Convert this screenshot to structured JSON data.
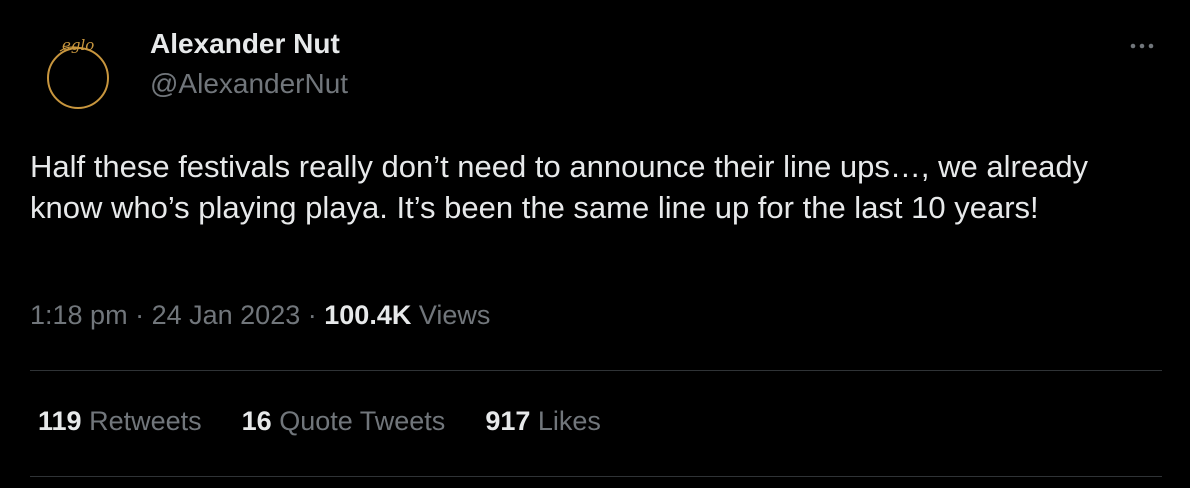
{
  "author": {
    "name": "Alexander Nut",
    "handle": "@AlexanderNut",
    "avatar_text": "eglo",
    "avatar_color": "#c8963e"
  },
  "tweet": {
    "text": "Half these festivals really don’t need to announce their line ups…, we already know who’s playing playa. It’s been the same line up for the last 10 years!",
    "time": "1:18 pm",
    "separator": "·",
    "date": "24 Jan 2023",
    "views_count": "100.4K",
    "views_label": "Views"
  },
  "stats": {
    "retweets": {
      "count": "119",
      "label": "Retweets"
    },
    "quotes": {
      "count": "16",
      "label": "Quote Tweets"
    },
    "likes": {
      "count": "917",
      "label": "Likes"
    }
  },
  "icons": {
    "more": "more-horizontal-icon"
  },
  "colors": {
    "background": "#000000",
    "text_primary": "#e7e9ea",
    "text_secondary": "#71767b",
    "divider": "#2f3336"
  }
}
